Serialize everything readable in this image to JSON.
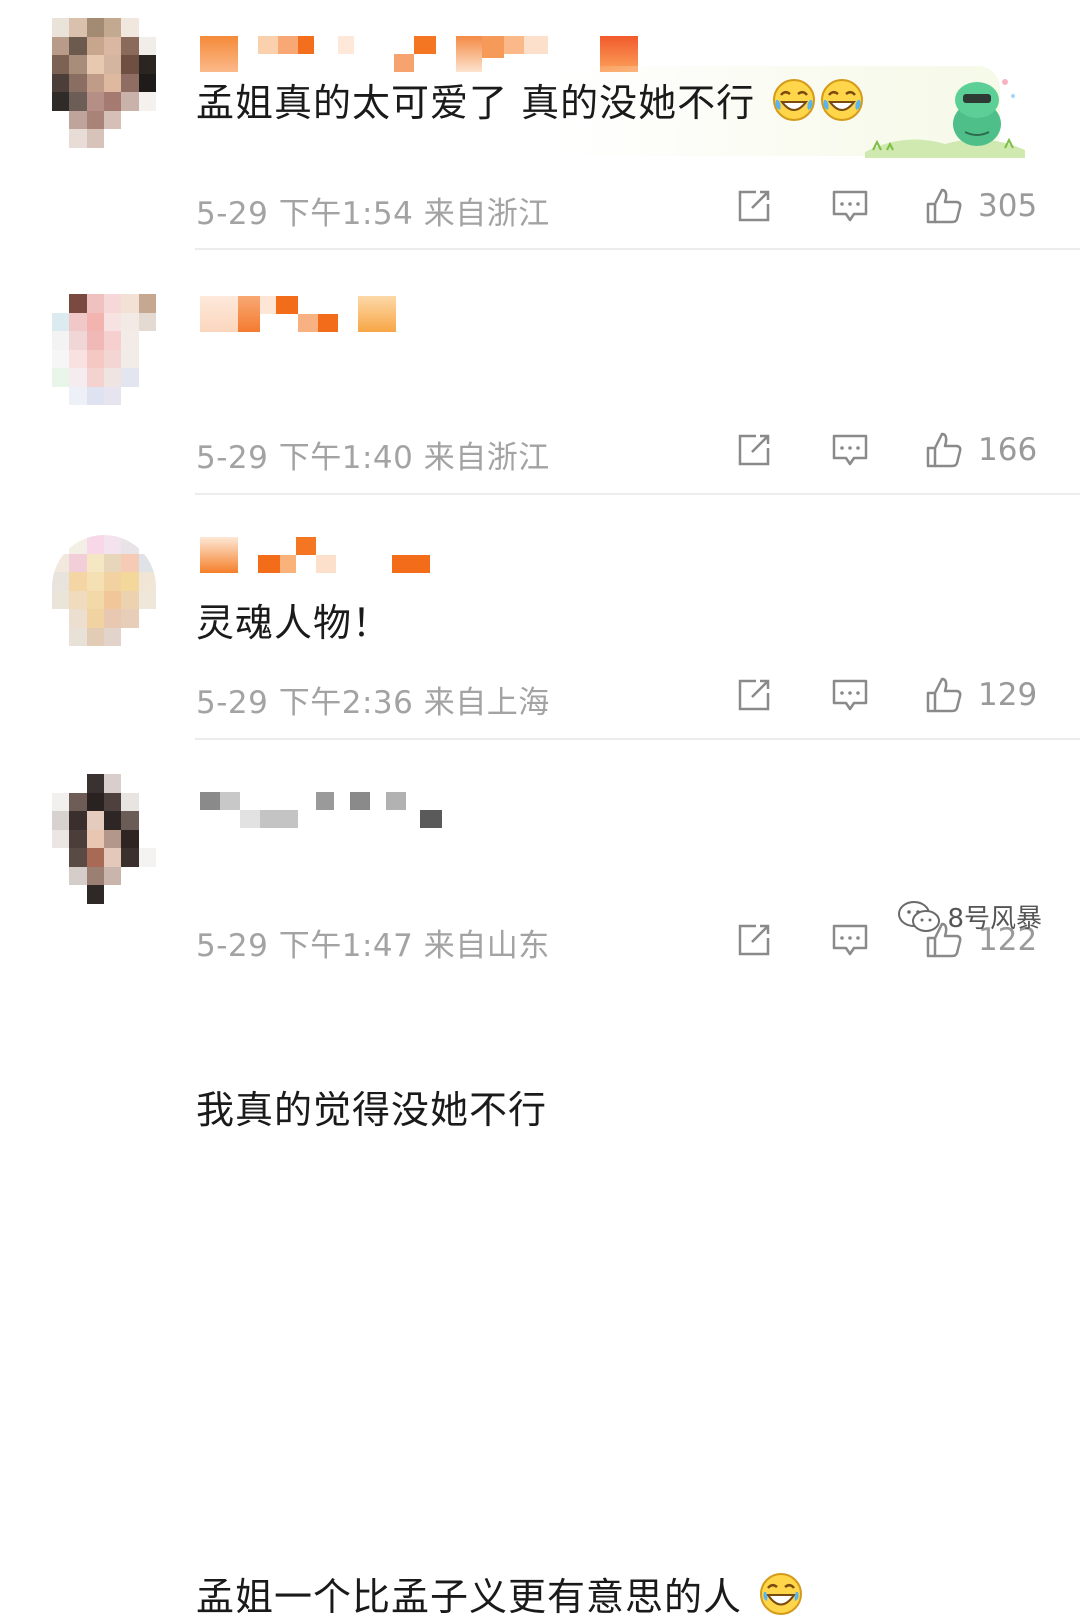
{
  "comments": [
    {
      "text": "孟姐真的太可爱了 真的没她不行",
      "emoji": [
        "laugh-cry-emoji",
        "laugh-cry-emoji"
      ],
      "date": "5-29",
      "time": "下午1:54",
      "location": "来自浙江",
      "likes": "305"
    },
    {
      "text": "灵魂人物！",
      "date": "5-29",
      "time": "下午1:40",
      "location": "来自浙江",
      "likes": "166"
    },
    {
      "text": "我真的觉得没她不行",
      "date": "5-29",
      "time": "下午2:36",
      "location": "来自上海",
      "likes": "129"
    },
    {
      "text": "孟姐一个比孟子义更有意思的人",
      "emoji": [
        "laughing-emoji"
      ],
      "date": "5-29",
      "time": "下午1:47",
      "location": "来自山东",
      "likes": "122"
    }
  ],
  "watermark": {
    "text": "8号风暴"
  },
  "colors": {
    "username_orange": "#f77b25",
    "meta_gray": "#a3a3a3",
    "icon_gray": "#8a8a8a"
  }
}
